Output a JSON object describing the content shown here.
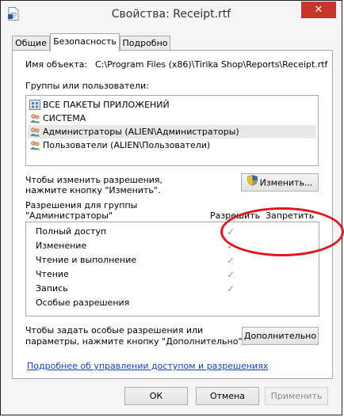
{
  "window": {
    "title": "Свойства: Receipt.rtf",
    "close_label": "✕"
  },
  "tabs": [
    {
      "label": "Общие"
    },
    {
      "label": "Безопасность"
    },
    {
      "label": "Подробно"
    }
  ],
  "object": {
    "label": "Имя объекта:",
    "value": "C:\\Program Files (x86)\\Tirika Shop\\Reports\\Receipt.rtf"
  },
  "groups": {
    "label": "Группы или пользователи:",
    "items": [
      {
        "label": "ВСЕ ПАКЕТЫ ПРИЛОЖЕНИЙ",
        "icon": "app-packages-icon"
      },
      {
        "label": "СИСТЕМА",
        "icon": "users-icon"
      },
      {
        "label": "Администраторы (ALIEN\\Администраторы)",
        "icon": "users-icon",
        "selected": true
      },
      {
        "label": "Пользователи (ALIEN\\Пользователи)",
        "icon": "users-icon"
      }
    ]
  },
  "change": {
    "hint_line1": "Чтобы изменить разрешения,",
    "hint_line2": "нажмите кнопку \"Изменить\".",
    "button_label": "Изменить..."
  },
  "permissions": {
    "label_line1": "Разрешения для группы",
    "label_line2": "\"Администраторы\"",
    "allow_header": "Разрешить",
    "deny_header": "Запретить",
    "rows": [
      {
        "name": "Полный доступ",
        "allow": true
      },
      {
        "name": "Изменение",
        "allow": true
      },
      {
        "name": "Чтение и выполнение",
        "allow": true
      },
      {
        "name": "Чтение",
        "allow": true
      },
      {
        "name": "Запись",
        "allow": true
      },
      {
        "name": "Особые разрешения",
        "allow": false
      }
    ]
  },
  "advanced": {
    "hint_line1": "Чтобы задать особые разрешения или",
    "hint_line2": "параметры, нажмите кнопку \"Дополнительно\".",
    "button_label": "Дополнительно"
  },
  "link_text": "Подробнее об управлении доступом и разрешениях",
  "footer": {
    "ok": "ОК",
    "cancel": "Отмена",
    "apply": "Применить"
  },
  "colors": {
    "annotation": "#e0161e",
    "link": "#1a3fc0",
    "close": "#c7352b"
  }
}
